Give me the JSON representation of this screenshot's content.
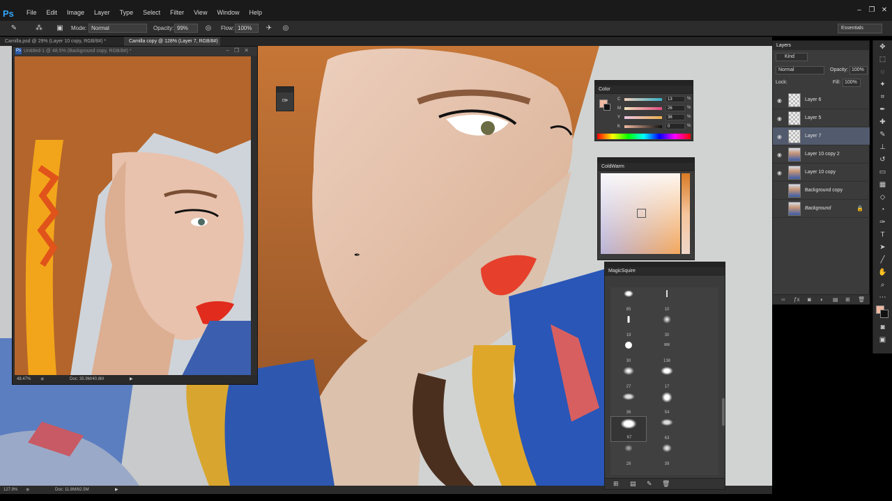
{
  "app": {
    "logo": "Ps",
    "menus": [
      "File",
      "Edit",
      "Image",
      "Layer",
      "Type",
      "Select",
      "Filter",
      "View",
      "Window",
      "Help"
    ]
  },
  "options": {
    "mode_label": "Mode:",
    "mode_value": "Normal",
    "opacity_label": "Opacity:",
    "opacity_value": "99%",
    "flow_label": "Flow:",
    "flow_value": "100%",
    "workspace": "Essentials"
  },
  "tabs": [
    {
      "label": "Camilla.psd @ 29% (Layer 10 copy, RGB/8#) *",
      "active": false
    },
    {
      "label": "Camilla copy @ 128% (Layer 7, RGB/8#) *",
      "active": true
    }
  ],
  "docwin": {
    "title": "Untitled-1 @ 48.5% (Background copy, RGB/8#) *",
    "zoom": "48.47%",
    "doc": "Doc: 35.9M/40.8M"
  },
  "status": {
    "zoom": "127.9%",
    "doc": "Doc: 11.8M/82.5M"
  },
  "layers_panel": {
    "tab": "Layers",
    "kind": "Kind",
    "blend": "Normal",
    "opacity_label": "Opacity:",
    "opacity_value": "100%",
    "lock_label": "Lock:",
    "fill_label": "Fill:",
    "fill_value": "100%",
    "layers": [
      {
        "name": "Layer 6",
        "thumb": "trans",
        "selected": false,
        "visible": true
      },
      {
        "name": "Layer 5",
        "thumb": "trans",
        "selected": false,
        "visible": true
      },
      {
        "name": "Layer 7",
        "thumb": "trans",
        "selected": true,
        "visible": true
      },
      {
        "name": "Layer 10 copy 2",
        "thumb": "pic",
        "selected": false,
        "visible": true
      },
      {
        "name": "Layer 10 copy",
        "thumb": "pic",
        "selected": false,
        "visible": true
      },
      {
        "name": "Background copy",
        "thumb": "pic",
        "selected": false,
        "visible": false
      },
      {
        "name": "Background",
        "thumb": "pic",
        "selected": false,
        "visible": false,
        "locked": true
      }
    ]
  },
  "color_panel": {
    "title": "Color",
    "foreground": "#f0b9a0",
    "background": "#111111",
    "channels": [
      {
        "label": "C",
        "value": "13"
      },
      {
        "label": "M",
        "value": "26"
      },
      {
        "label": "Y",
        "value": "36"
      },
      {
        "label": "K",
        "value": "0"
      }
    ],
    "pct": "%"
  },
  "coldwarm_panel": {
    "title": "ColdWarm"
  },
  "magic_panel": {
    "title": "MagicSquire",
    "brushes": [
      "85",
      "10",
      "19",
      "30",
      "30",
      "138",
      "27",
      "17",
      "36",
      "54",
      "67",
      "63",
      "28",
      "39"
    ]
  },
  "colors": {
    "accent": "#31a8ff",
    "selected_layer": "#525a6e"
  }
}
